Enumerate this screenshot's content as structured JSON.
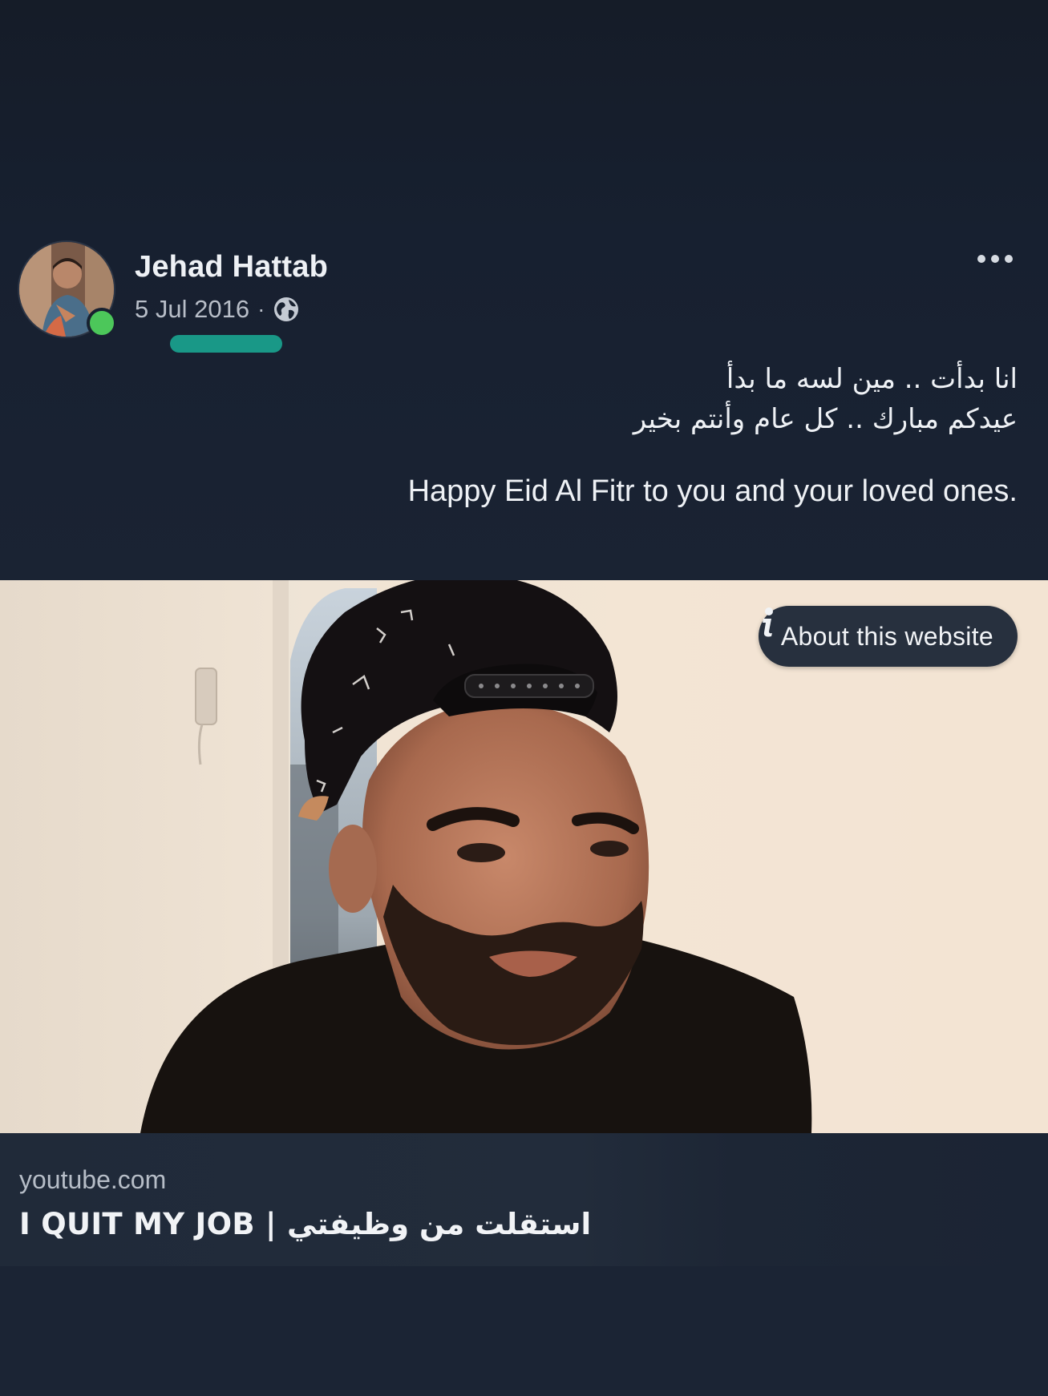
{
  "post": {
    "author_name": "Jehad Hattab",
    "date": "5 Jul 2016",
    "separator": "·",
    "privacy_icon": "globe-icon",
    "online_status": "online",
    "text_lines_ar": [
      "انا بدأت .. مين لسه ما بدأ",
      "عيدكم مبارك .. كل عام وأنتم بخير"
    ],
    "text_en": "Happy Eid Al Fitr to you and your loved ones."
  },
  "link_preview": {
    "about_label": "About this website",
    "domain": "youtube.com",
    "title": "I QUIT MY JOB | استقلت من وظيفتي"
  },
  "colors": {
    "background": "#182130",
    "online": "#4cc75a",
    "redaction": "#1aa38e",
    "pill": "#27303e"
  }
}
